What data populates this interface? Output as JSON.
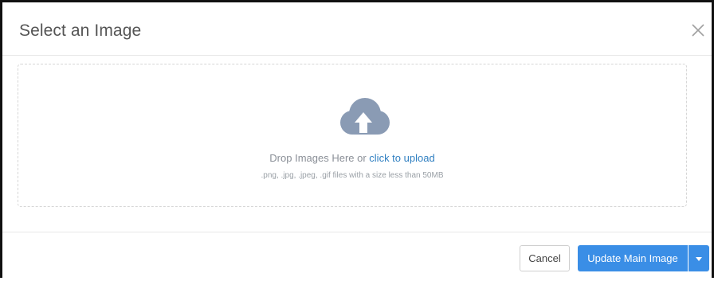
{
  "modal": {
    "title": "Select an Image"
  },
  "dropzone": {
    "prompt_text": "Drop Images Here or ",
    "link_text": "click to upload",
    "hint_text": ".png, .jpg, .jpeg, .gif files with a size less than 50MB",
    "icon": "cloud-upload-icon"
  },
  "footer": {
    "cancel_label": "Cancel",
    "primary_label": "Update Main Image",
    "dropdown_icon": "caret-down-icon"
  },
  "colors": {
    "accent": "#3a8ee6",
    "link": "#2f7fc1",
    "icon": "#8a9bb4"
  }
}
